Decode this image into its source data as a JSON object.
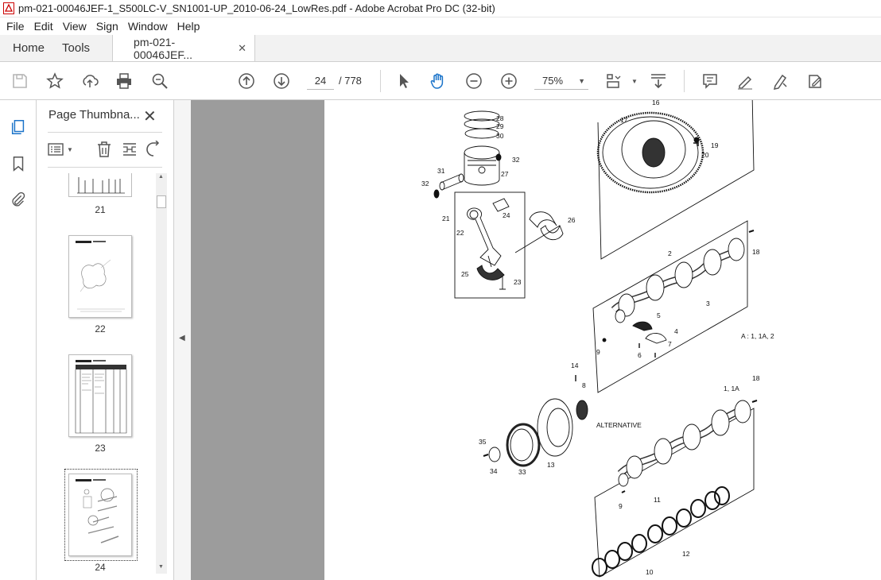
{
  "window": {
    "title": "pm-021-00046JEF-1_S500LC-V_SN1001-UP_2010-06-24_LowRes.pdf - Adobe Acrobat Pro DC (32-bit)"
  },
  "menu": [
    "File",
    "Edit",
    "View",
    "Sign",
    "Window",
    "Help"
  ],
  "tabs": {
    "home": "Home",
    "tools": "Tools",
    "doc": "pm-021-00046JEF...",
    "close": "✕"
  },
  "toolbar": {
    "page_current": "24",
    "page_total": "/ 778",
    "zoom": "75%"
  },
  "panel": {
    "title": "Page Thumbna...",
    "close": "✕"
  },
  "thumbnails": [
    {
      "label": "21"
    },
    {
      "label": "22"
    },
    {
      "label": "23"
    },
    {
      "label": "24",
      "selected": true
    }
  ],
  "diagram": {
    "callouts": [
      "28",
      "29",
      "30",
      "31",
      "32",
      "27",
      "32",
      "21",
      "24",
      "22",
      "26",
      "25",
      "23",
      "16",
      "17",
      "19",
      "20",
      "18",
      "2",
      "3",
      "5",
      "4",
      "7",
      "6",
      "9",
      "A : 1, 1A, 2",
      "14",
      "8",
      "18",
      "1, 1A",
      "ALTERNATIVE",
      "35",
      "34",
      "33",
      "13",
      "9",
      "11",
      "12",
      "10"
    ]
  }
}
